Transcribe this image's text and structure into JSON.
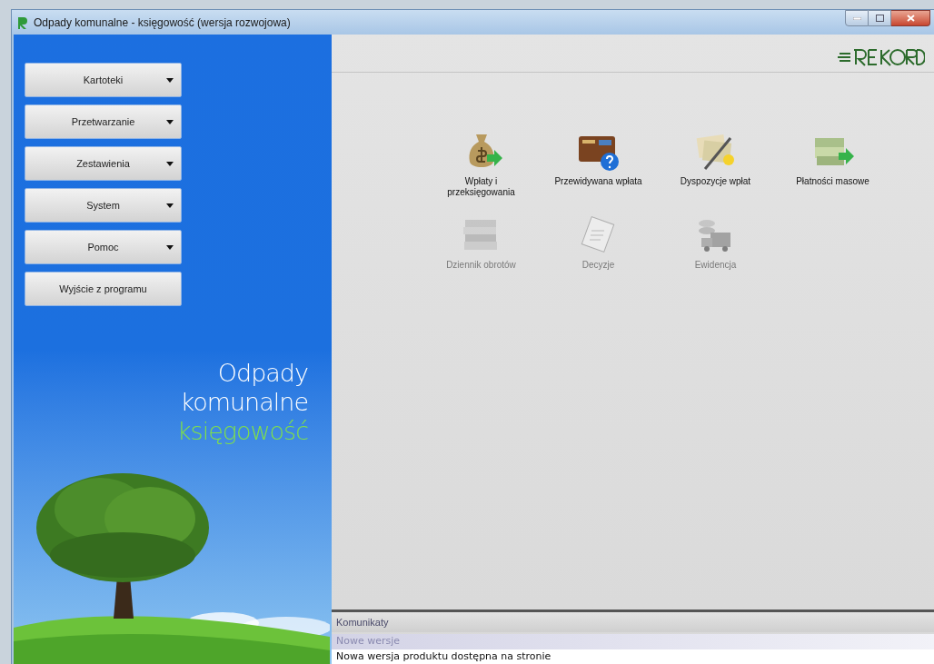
{
  "window": {
    "title": "Odpady komunalne - księgowość (wersja rozwojowa)"
  },
  "menu": [
    {
      "label": "Kartoteki",
      "kind": "dropdown"
    },
    {
      "label": "Przetwarzanie",
      "kind": "dropdown"
    },
    {
      "label": "Zestawienia",
      "kind": "dropdown"
    },
    {
      "label": "System",
      "kind": "dropdown"
    },
    {
      "label": "Pomoc",
      "kind": "dropdown"
    },
    {
      "label": "Wyjście z programu",
      "kind": "plain"
    }
  ],
  "branding": {
    "line_1": "Odpady",
    "line_2": "komunalne",
    "line_3": "księgowość"
  },
  "tiles": [
    {
      "label": "Wpłaty i przeksięgowania",
      "kind": "moneybag",
      "disabled": false
    },
    {
      "label": "Przewidywana wpłata",
      "kind": "wallet",
      "disabled": false
    },
    {
      "label": "Dyspozycje wpłat",
      "kind": "cheque",
      "disabled": false
    },
    {
      "label": "Płatności masowe",
      "kind": "banknotes",
      "disabled": false
    },
    {
      "label": "Dziennik obrotów",
      "kind": "papers",
      "disabled": true
    },
    {
      "label": "Decyzje",
      "kind": "document",
      "disabled": true
    },
    {
      "label": "Ewidencja",
      "kind": "truck",
      "disabled": true
    }
  ],
  "messages": {
    "title": "Komunikaty",
    "group": "Nowe wersje",
    "text": "Nowa wersja produktu dostępna na stronie"
  }
}
